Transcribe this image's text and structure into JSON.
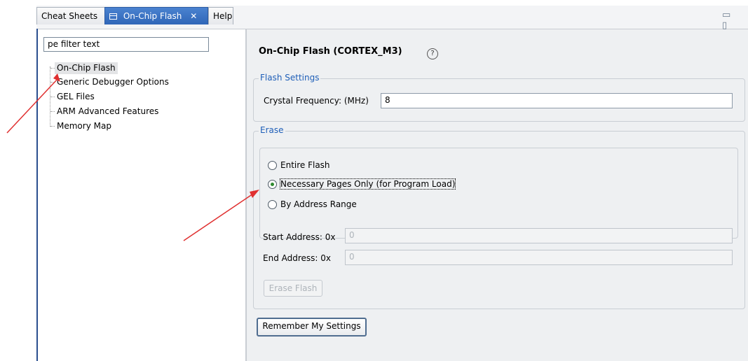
{
  "tabs": [
    {
      "label": "Cheat Sheets",
      "active": false
    },
    {
      "label": "On-Chip Flash",
      "active": true
    },
    {
      "label": "Help",
      "active": false
    }
  ],
  "tab_close_glyph": "✕",
  "win_controls": "▭ ▯",
  "tree": {
    "filter_value": "pe filter text",
    "items": [
      {
        "label": "On-Chip Flash",
        "selected": true
      },
      {
        "label": "Generic Debugger Options",
        "selected": false
      },
      {
        "label": "GEL Files",
        "selected": false
      },
      {
        "label": "ARM Advanced Features",
        "selected": false
      },
      {
        "label": "Memory Map",
        "selected": false
      }
    ]
  },
  "page": {
    "title": "On-Chip Flash (CORTEX_M3)",
    "help_glyph": "?"
  },
  "flash_settings": {
    "group_label": "Flash Settings",
    "crystal_label": "Crystal Frequency: (MHz)",
    "crystal_value": "8"
  },
  "erase": {
    "group_label": "Erase",
    "options": [
      {
        "label": "Entire Flash",
        "checked": false
      },
      {
        "label": "Necessary Pages Only (for Program Load)",
        "checked": true
      },
      {
        "label": "By Address Range",
        "checked": false
      }
    ],
    "start_label": "Start Address: 0x",
    "start_value": "0",
    "end_label": "End Address: 0x",
    "end_value": "0",
    "erase_button": "Erase Flash"
  },
  "remember_button": "Remember My Settings",
  "colors": {
    "accent": "#1f5fb8",
    "active_tab": "#3a72c4",
    "annotation_arrow": "#e03030",
    "radio_dot": "#2f8a2f"
  },
  "icons": [
    "view-icon",
    "close-icon",
    "help-icon",
    "minimize-icon",
    "maximize-icon"
  ]
}
